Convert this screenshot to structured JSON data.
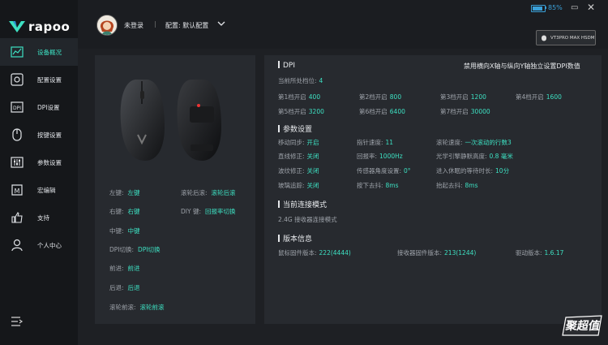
{
  "app": {
    "brand": "rapoo",
    "battery_percent": "85%",
    "battery_level": 0.85,
    "minimize": "▭",
    "close": "✕"
  },
  "header": {
    "user_status": "未登录",
    "separator": "|",
    "config_label": "配置: 默认配置"
  },
  "device": {
    "name": "VT3PRO MAX HSDM"
  },
  "sidebar": {
    "items": [
      {
        "label": "设备概况",
        "icon": "overview-chart-icon"
      },
      {
        "label": "配置设置",
        "icon": "settings-icon"
      },
      {
        "label": "DPI设置",
        "icon": "dpi-icon"
      },
      {
        "label": "按键设置",
        "icon": "mouse-button-icon"
      },
      {
        "label": "参数设置",
        "icon": "sliders-icon"
      },
      {
        "label": "宏编辑",
        "icon": "macro-icon"
      },
      {
        "label": "支持",
        "icon": "thumbs-up-icon"
      },
      {
        "label": "个人中心",
        "icon": "user-icon"
      }
    ]
  },
  "buttons": {
    "left": {
      "key": "左键:",
      "value": "左键"
    },
    "wheel_back": {
      "key": "滚轮后滚:",
      "value": "滚轮后滚"
    },
    "right": {
      "key": "右键:",
      "value": "右键"
    },
    "diy": {
      "key": "DIY 键:",
      "value": "回报率切换"
    },
    "middle": {
      "key": "中键:",
      "value": "中键"
    },
    "dpi_switch": {
      "key": "DPI切换:",
      "value": "DPI切换"
    },
    "forward": {
      "key": "前进:",
      "value": "前进"
    },
    "back": {
      "key": "后退:",
      "value": "后退"
    },
    "wheel_forward": {
      "key": "滚轮前滚:",
      "value": "滚轮前滚"
    }
  },
  "dpi": {
    "title": "DPI",
    "note": "禁用横向X轴与纵向Y轴独立设置DPI数值",
    "current_label": "当前所处档位:",
    "current_value": "4",
    "levels": [
      {
        "label": "第1档开启",
        "value": "400"
      },
      {
        "label": "第2档开启",
        "value": "800"
      },
      {
        "label": "第3档开启",
        "value": "1200"
      },
      {
        "label": "第4档开启",
        "value": "1600"
      },
      {
        "label": "第5档开启",
        "value": "3200"
      },
      {
        "label": "第6档开启",
        "value": "6400"
      },
      {
        "label": "第7档开启",
        "value": "30000"
      }
    ]
  },
  "params": {
    "title": "参数设置",
    "rows": [
      [
        {
          "label": "移动同步:",
          "value": "开启"
        },
        {
          "label": "指针速度:",
          "value": "11"
        },
        {
          "label": "滚轮速度:",
          "value": "一次滚动的行数3"
        }
      ],
      [
        {
          "label": "直线修正:",
          "value": "关闭"
        },
        {
          "label": "回报率:",
          "value": "1000Hz"
        },
        {
          "label": "光学引擎静默高度:",
          "value": "0.8 毫米"
        }
      ],
      [
        {
          "label": "波纹修正:",
          "value": "关闭"
        },
        {
          "label": "传感器角度设置:",
          "value": "0°"
        },
        {
          "label": "进入休眠的等待时长:",
          "value": "10分"
        }
      ],
      [
        {
          "label": "玻璃追踪:",
          "value": "关闭"
        },
        {
          "label": "按下去抖:",
          "value": "8ms"
        },
        {
          "label": "抬起去抖:",
          "value": "8ms"
        }
      ]
    ]
  },
  "connection": {
    "title": "当前连接模式",
    "value": "2.4G 接收器连接模式"
  },
  "version": {
    "title": "版本信息",
    "items": [
      {
        "label": "鼠标固件版本:",
        "value": "222(4444)"
      },
      {
        "label": "接收器固件版本:",
        "value": "213(1244)"
      },
      {
        "label": "驱动版本:",
        "value": "1.6.17"
      }
    ]
  },
  "watermark": "聚超值"
}
